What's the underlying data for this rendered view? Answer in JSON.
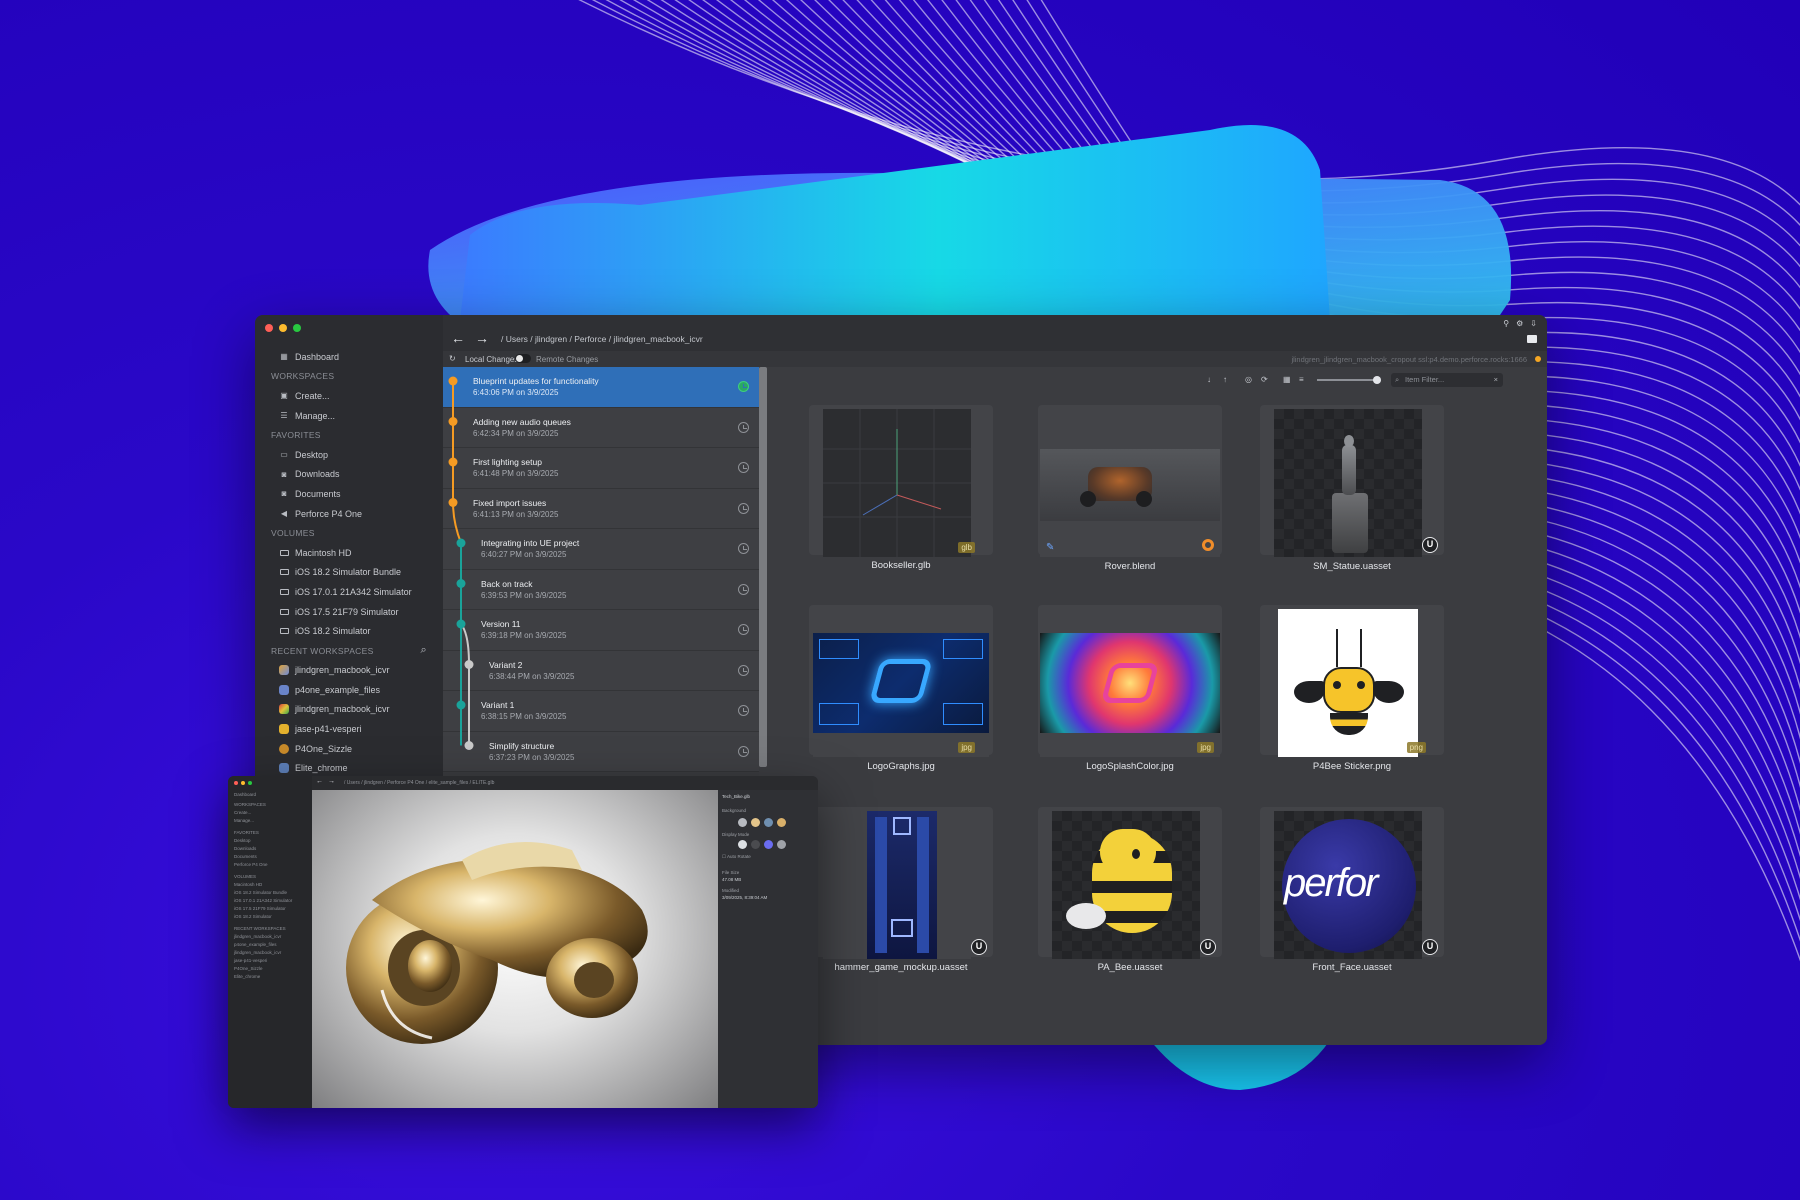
{
  "sidebar": {
    "dashboard": "Dashboard",
    "workspaces_header": "WORKSPACES",
    "workspaces": [
      "Create...",
      "Manage..."
    ],
    "favorites_header": "FAVORITES",
    "favorites": [
      "Desktop",
      "Downloads",
      "Documents",
      "Perforce P4 One"
    ],
    "volumes_header": "VOLUMES",
    "volumes": [
      "Macintosh HD",
      "iOS 18.2 Simulator Bundle",
      "iOS 17.0.1 21A342 Simulator",
      "iOS 17.5 21F79 Simulator",
      "iOS 18.2 Simulator"
    ],
    "recent_header": "RECENT WORKSPACES",
    "recent": [
      "jlindgren_macbook_icvr",
      "p4one_example_files",
      "jlindgren_macbook_icvr",
      "jase-p41-vesperi",
      "P4One_Sizzle",
      "Elite_chrome"
    ]
  },
  "toolbar": {
    "back": "←",
    "forward": "→",
    "breadcrumb": "/ Users / jlindgren / Perforce / jlindgren_macbook_icvr",
    "window_icons": [
      "⚲",
      "⚙",
      "⇩"
    ]
  },
  "status": {
    "sync_icon": "↻",
    "local_changes": "Local Changes",
    "remote_changes": "Remote Changes",
    "server": "jlindgren_jlindgren_macbook_cropout  ssl:p4.demo.perforce.rocks:1666",
    "status_color": "#f5a623"
  },
  "history": [
    {
      "title": "Blueprint updates for functionality",
      "time": "6:43:06 PM on 3/9/2025",
      "selected": true
    },
    {
      "title": "Adding new audio queues",
      "time": "6:42:34 PM on 3/9/2025"
    },
    {
      "title": "First lighting setup",
      "time": "6:41:48 PM on 3/9/2025"
    },
    {
      "title": "Fixed import issues",
      "time": "6:41:13 PM on 3/9/2025"
    },
    {
      "title": "Integrating into UE project",
      "time": "6:40:27 PM on 3/9/2025"
    },
    {
      "title": "Back on track",
      "time": "6:39:53 PM on 3/9/2025"
    },
    {
      "title": "Version 11",
      "time": "6:39:18 PM on 3/9/2025"
    },
    {
      "title": "Variant 2",
      "time": "6:38:44 PM on 3/9/2025"
    },
    {
      "title": "Variant 1",
      "time": "6:38:15 PM on 3/9/2025"
    },
    {
      "title": "Simplify structure",
      "time": "6:37:23 PM on 3/9/2025"
    }
  ],
  "asset_tools": {
    "icons": [
      "↓",
      "↑",
      "◎",
      "⟳",
      "▦",
      "≡"
    ],
    "filter_placeholder": "Item Filter...",
    "search_icon": "⌕",
    "clear_icon": "×"
  },
  "assets": [
    {
      "name": "Bookseller.glb",
      "badge": "glb"
    },
    {
      "name": "Rover.blend",
      "badge": ""
    },
    {
      "name": "SM_Statue.uasset",
      "badge": ""
    },
    {
      "name": "LogoGraphs.jpg",
      "badge": "jpg"
    },
    {
      "name": "LogoSplashColor.jpg",
      "badge": "jpg"
    },
    {
      "name": "P4Bee Sticker.png",
      "badge": "png"
    },
    {
      "name": "hammer_game_mockup.uasset",
      "badge": ""
    },
    {
      "name": "PA_Bee.uasset",
      "badge": ""
    },
    {
      "name": "Front_Face.uasset",
      "badge": ""
    }
  ],
  "ue_glyph": "U",
  "thumb_text": {
    "front_face": "perfor"
  },
  "viewer": {
    "breadcrumb": "/ Users / jlindgren / Perforce P4 One / elite_sample_files / ELITE.glb",
    "file_name": "Tech_Bike.glb",
    "bg_label": "Background",
    "display_label": "Display Mode",
    "auto_rotate": "Auto Rotate",
    "size_label": "File Size",
    "size_value": "47.08 MB",
    "modified_label": "Modified",
    "modified_value": "3/09/2025, 8:39:04 AM"
  },
  "colors": {
    "accent_blue": "#2f6fb8",
    "graph_orange": "#f59b23",
    "graph_teal": "#1aa39a",
    "graph_gray": "#c9c9c9"
  }
}
